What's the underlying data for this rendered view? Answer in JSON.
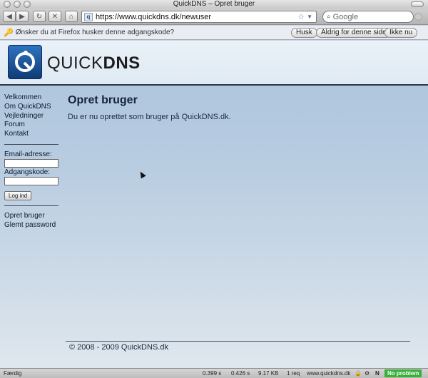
{
  "window": {
    "title": "QuickDNS – Opret bruger"
  },
  "toolbar": {
    "back_label": "◀",
    "forward_label": "▶",
    "reload_label": "↻",
    "stop_label": "✕",
    "home_label": "⌂",
    "url": "https://www.quickdns.dk/newuser",
    "search_placeholder": "Google"
  },
  "notification": {
    "message": "Ønsker du at Firefox husker denne adgangskode?",
    "remember_label": "Husk",
    "never_label": "Aldrig for denne side",
    "notnow_label": "Ikke nu"
  },
  "header": {
    "logo_light": "QUICK",
    "logo_bold": "DNS"
  },
  "sidebar": {
    "nav": [
      "Velkommen",
      "Om QuickDNS",
      "Vejledninger",
      "Forum",
      "Kontakt"
    ],
    "email_label": "Email-adresse:",
    "password_label": "Adgangskode:",
    "login_label": "Log ind",
    "account_links": [
      "Opret bruger",
      "Glemt password"
    ]
  },
  "main": {
    "heading": "Opret bruger",
    "message": "Du er nu oprettet som bruger på QuickDNS.dk."
  },
  "footer": {
    "text": "© 2008 - 2009 QuickDNS.dk"
  },
  "statusbar": {
    "status": "Færdig",
    "time1": "0.399 s",
    "time2": "0.426 s",
    "size": "9.17 KB",
    "requests": "1 req",
    "host": "www.quickdns.dk",
    "badge": "No problem"
  },
  "colors": {
    "badge_green": "#38b03a",
    "page_blue": "#aac3dc",
    "header_border": "#2e3640"
  }
}
